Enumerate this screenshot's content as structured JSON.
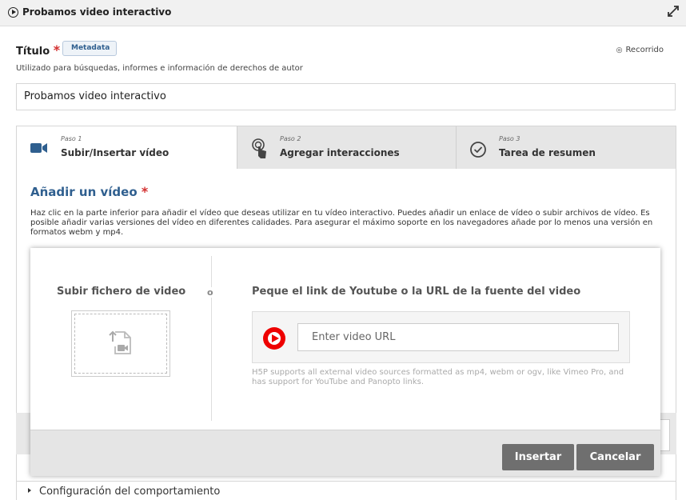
{
  "window": {
    "title": "Probamos video interactivo"
  },
  "title_field": {
    "label": "Título",
    "required_mark": "*",
    "metadata_button": "Metadata",
    "tour_link": "Recorrido",
    "description": "Utilizado para búsquedas, informes e información de derechos de autor",
    "value": "Probamos video interactivo"
  },
  "steps": [
    {
      "step": "Paso 1",
      "label": "Subir/Insertar vídeo",
      "icon": "video-camera-icon",
      "active": true
    },
    {
      "step": "Paso 2",
      "label": "Agregar interacciones",
      "icon": "pointer-touch-icon",
      "active": false
    },
    {
      "step": "Paso 3",
      "label": "Tarea de resumen",
      "icon": "check-circle-icon",
      "active": false
    }
  ],
  "add_video": {
    "heading": "Añadir un vídeo",
    "required_mark": "*",
    "description": "Haz clic en la parte inferior para añadir el vídeo que deseas utilizar en tu vídeo interactivo. Puedes añadir un enlace de vídeo o subir archivos de vídeo. Es posible añadir varias versiones del vídeo en diferentes calidades. Para asegurar el máximo soporte en los navegadores añade por lo menos una versión en formatos webm y mp4."
  },
  "dialog": {
    "upload_heading": "Subir fichero de video",
    "or_label": "o",
    "url_heading": "Peque el link de Youtube o la URL de la fuente del video",
    "url_placeholder": "Enter video URL",
    "hint": "H5P supports all external video sources formatted as mp4, webm or ogv, like Vimeo Pro, and has support for YouTube and Panopto links.",
    "insert_button": "Insertar",
    "cancel_button": "Cancelar"
  },
  "behaviour": {
    "label": "Configuración del comportamiento"
  },
  "colors": {
    "accent_blue": "#2f5f8f",
    "required_red": "#d32f2f",
    "youtube_red": "#e00000",
    "button_grey": "#6f6f6f"
  }
}
